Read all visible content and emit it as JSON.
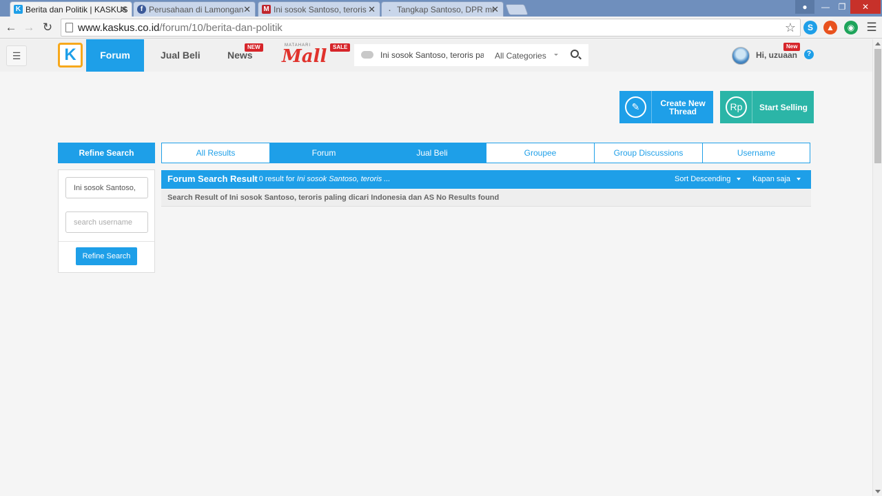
{
  "browser": {
    "tabs": [
      {
        "title": "Berita dan Politik | KASKUS",
        "favicon": "K",
        "color": "#1e9fe8"
      },
      {
        "title": "Perusahaan di Lamongan",
        "favicon": "f",
        "color": "#3b5998"
      },
      {
        "title": "Ini sosok Santoso, teroris",
        "favicon": "M",
        "color": "#c0262d"
      },
      {
        "title": "Tangkap Santoso, DPR mi",
        "favicon": ".",
        "color": "#999999"
      }
    ],
    "url_domain": "www.kaskus.co.id",
    "url_path": "/forum/10/berita-dan-politik"
  },
  "header": {
    "nav_forum": "Forum",
    "nav_jual_beli": "Jual Beli",
    "nav_news": "News",
    "news_badge": "NEW",
    "mall_small": "MATAHARI",
    "mall_big": "Mall",
    "mall_badge": "SALE",
    "search_query": "Ini sosok Santoso, teroris pa",
    "category": "All Categories",
    "greeting": "Hi, uzuaan",
    "user_badge": "New",
    "help": "?"
  },
  "actions": {
    "create_label_1": "Create New",
    "create_label_2": "Thread",
    "sell_label": "Start Selling",
    "sell_icon_text": "Rp"
  },
  "sidebar": {
    "title": "Refine Search",
    "query_value": "Ini sosok Santoso,",
    "username_placeholder": "search username",
    "button": "Refine Search"
  },
  "result_tabs": [
    "All Results",
    "Forum",
    "Jual Beli",
    "Groupee",
    "Group Discussions",
    "Username"
  ],
  "results": {
    "title": "Forum Search Result",
    "summary_prefix": "- 0 result for",
    "summary_query": "Ini sosok Santoso, teroris ...",
    "sort": "Sort Descending",
    "when": "Kapan saja",
    "message": "Search Result of Ini sosok Santoso, teroris paling dicari Indonesia dan AS No Results found"
  }
}
